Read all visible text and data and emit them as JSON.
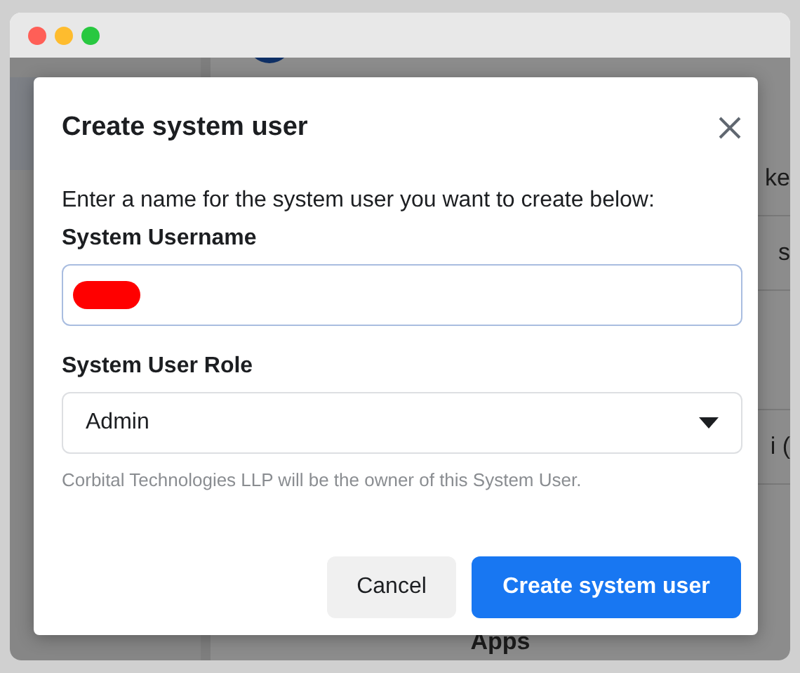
{
  "background": {
    "rows": [
      {
        "text": "ke"
      },
      {
        "text": "s"
      },
      {
        "text": "i ("
      }
    ],
    "footer": "Apps"
  },
  "dialog": {
    "title": "Create system user",
    "description": "Enter a name for the system user you want to create below:",
    "username": {
      "label": "System Username"
    },
    "role": {
      "label": "System User Role",
      "value": "Admin"
    },
    "helper": "Corbital Technologies LLP will be the owner of this System User.",
    "buttons": [
      {
        "label": "Cancel",
        "kind": "secondary"
      },
      {
        "label": "Create system user",
        "kind": "primary"
      }
    ]
  }
}
